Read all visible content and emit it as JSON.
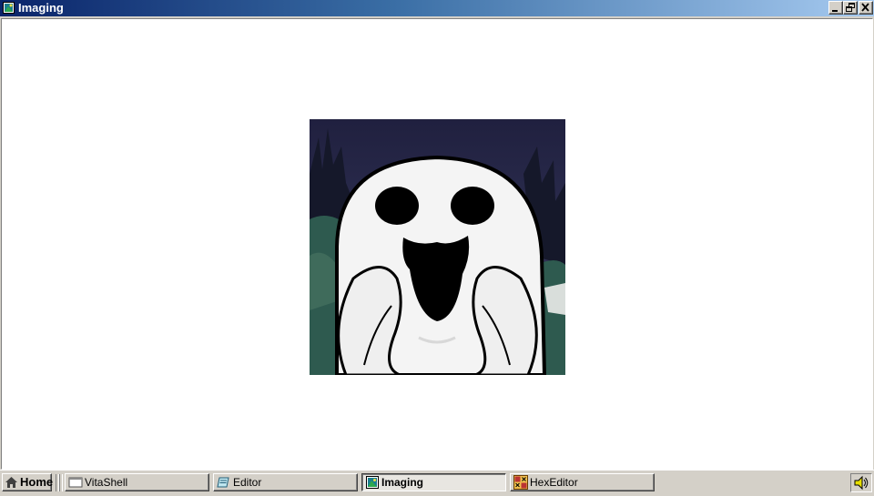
{
  "window": {
    "title": "Imaging",
    "icon": "imaging-app-icon",
    "controls": [
      "minimize-icon",
      "restore-icon",
      "close-icon"
    ],
    "image": {
      "subject": "scared-ghost-picture",
      "colors": {
        "sky": "#24244a",
        "ghost": "#f4f4f4",
        "foliage": "#2f5a50",
        "outline": "#000000"
      }
    }
  },
  "taskbar": {
    "home": {
      "label": "Home",
      "icon": "home-icon"
    },
    "tasks": [
      {
        "label": "VitaShell",
        "icon": "vitashell-icon",
        "active": false
      },
      {
        "label": "Editor",
        "icon": "editor-icon",
        "active": false
      },
      {
        "label": "Imaging",
        "icon": "imaging-app-icon",
        "active": true
      },
      {
        "label": "HexEditor",
        "icon": "hexeditor-icon",
        "active": false
      }
    ],
    "tray": {
      "icon": "speaker-icon"
    }
  }
}
